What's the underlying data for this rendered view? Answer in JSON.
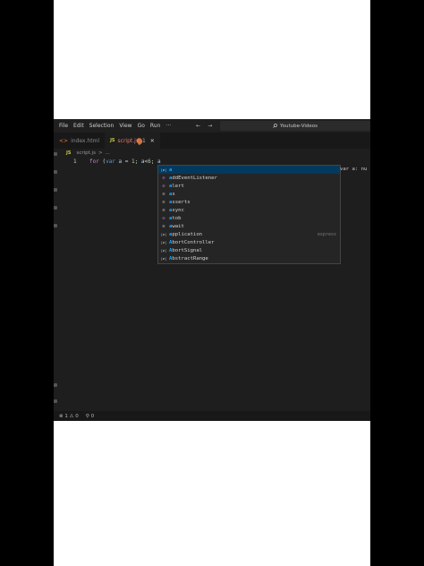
{
  "menubar": {
    "items": [
      "File",
      "Edit",
      "Selection",
      "View",
      "Go",
      "Run",
      "···"
    ],
    "back_icon": "←",
    "forward_icon": "→",
    "search_text": "Youtube-Videos"
  },
  "tabs": [
    {
      "label": "index.html",
      "icon": "<>"
    },
    {
      "label": "script.js",
      "icon": "JS",
      "count": "1",
      "close": "✕"
    }
  ],
  "breadcrumb": {
    "icon": "JS",
    "file": "script.js",
    "sep": ">",
    "rest": "..."
  },
  "editor": {
    "line_number": "1",
    "tokens": [
      {
        "t": "for",
        "c": "kw"
      },
      {
        "t": " (",
        "c": ""
      },
      {
        "t": "var",
        "c": "kw2"
      },
      {
        "t": " ",
        "c": ""
      },
      {
        "t": "a",
        "c": "var"
      },
      {
        "t": " = ",
        "c": ""
      },
      {
        "t": "1",
        "c": "num"
      },
      {
        "t": "; ",
        "c": ""
      },
      {
        "t": "a",
        "c": "var"
      },
      {
        "t": "<",
        "c": ""
      },
      {
        "t": "6",
        "c": "num"
      },
      {
        "t": "; ",
        "c": ""
      },
      {
        "t": "a",
        "c": "var"
      }
    ]
  },
  "suggestions": [
    {
      "icon": "[ø]",
      "kind": "var",
      "match": "a",
      "rest": "",
      "detail": ""
    },
    {
      "icon": "⊙",
      "kind": "fn",
      "match": "a",
      "rest": "ddEventListener",
      "detail": ""
    },
    {
      "icon": "⊙",
      "kind": "fn",
      "match": "a",
      "rest": "lert",
      "detail": ""
    },
    {
      "icon": "☰",
      "kind": "kw",
      "match": "a",
      "rest": "s",
      "detail": ""
    },
    {
      "icon": "☰",
      "kind": "kw",
      "match": "a",
      "rest": "sserts",
      "detail": ""
    },
    {
      "icon": "☰",
      "kind": "kw",
      "match": "a",
      "rest": "sync",
      "detail": ""
    },
    {
      "icon": "⊙",
      "kind": "fn",
      "match": "a",
      "rest": "tob",
      "detail": ""
    },
    {
      "icon": "☰",
      "kind": "kw",
      "match": "a",
      "rest": "wait",
      "detail": ""
    },
    {
      "icon": "[ø]",
      "kind": "var",
      "match": "a",
      "rest": "pplication",
      "detail": "express"
    },
    {
      "icon": "[ø]",
      "kind": "var",
      "match": "A",
      "rest": "bortController",
      "detail": ""
    },
    {
      "icon": "[ø]",
      "kind": "var",
      "match": "A",
      "rest": "bortSignal",
      "detail": ""
    },
    {
      "icon": "[ø]",
      "kind": "var",
      "match": "A",
      "rest": "bstractRange",
      "detail": ""
    }
  ],
  "hover_detail": "var a: nu",
  "status": {
    "errors": "⊗ 1 ⚠ 0",
    "ports": "⚲ 0"
  }
}
